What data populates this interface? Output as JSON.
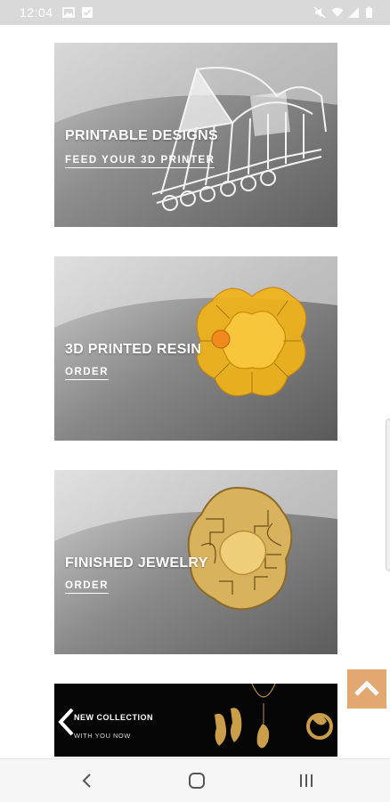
{
  "status_bar": {
    "time": "12:04",
    "left_icons": [
      "image-icon",
      "checkbox-icon"
    ],
    "right_icons": [
      "mute-icon",
      "wifi-icon",
      "signal-icon",
      "battery-icon"
    ]
  },
  "cards": [
    {
      "title": "PRINTABLE DESIGNS",
      "link": "FEED YOUR 3D PRINTER",
      "art": "wireframe-ring-model"
    },
    {
      "title": "3D PRINTED RESIN",
      "link": "ORDER",
      "art": "yellow-resin-flower-ring"
    },
    {
      "title": "FINISHED JEWELRY",
      "link": "ORDER",
      "art": "gold-filigree-ring"
    }
  ],
  "banner": {
    "title": "NEW COLLECTION",
    "subtitle": "WITH YOU NOW",
    "background_color": "#050505"
  },
  "scroll_top": {
    "icon": "chevron-up-icon",
    "color": "#e3a772"
  },
  "nav_bar": {
    "buttons": [
      "back-icon",
      "home-icon",
      "recents-icon"
    ]
  }
}
